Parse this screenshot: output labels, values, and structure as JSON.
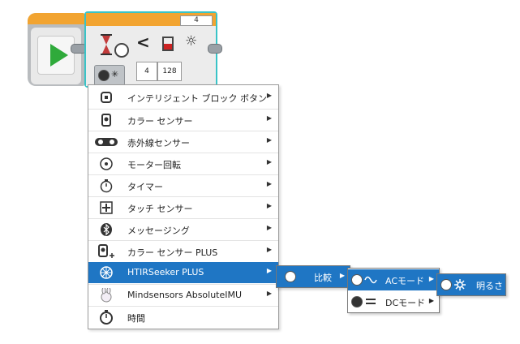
{
  "block": {
    "port": "4",
    "inputs": [
      "4",
      "128"
    ],
    "compare_symbol": "<",
    "sun_symbol": "☼",
    "mode_symbol": "✳"
  },
  "menu": {
    "items": [
      {
        "label": "インテリジェント ブロック ボタン",
        "icon": "brick-buttons-icon",
        "arrow": "▶"
      },
      {
        "label": "カラー センサー",
        "icon": "color-sensor-icon",
        "arrow": "▶"
      },
      {
        "label": "赤外線センサー",
        "icon": "infrared-sensor-icon",
        "arrow": "▶"
      },
      {
        "label": "モーター回転",
        "icon": "motor-rotation-icon",
        "arrow": "▶"
      },
      {
        "label": "タイマー",
        "icon": "timer-icon",
        "arrow": "▶"
      },
      {
        "label": "タッチ センサー",
        "icon": "touch-sensor-icon",
        "arrow": "▶"
      },
      {
        "label": "メッセージング",
        "icon": "bluetooth-icon",
        "arrow": "▶"
      },
      {
        "label": "カラー センサー PLUS",
        "icon": "color-sensor-plus-icon",
        "arrow": "▶"
      },
      {
        "label": "HTIRSeeker PLUS",
        "icon": "ir-seeker-icon",
        "arrow": "▶"
      },
      {
        "label": "Mindsensors AbsoluteIMU",
        "icon": "imu-icon",
        "arrow": "▶"
      },
      {
        "label": "時間",
        "icon": "time-icon",
        "arrow": ""
      }
    ],
    "selected_index": 8
  },
  "submenu1": {
    "label": "比較",
    "arrow": "▶"
  },
  "submenu2": {
    "items": [
      {
        "label": "ACモード",
        "arrow": "▶"
      },
      {
        "label": "DCモード",
        "arrow": "▶"
      }
    ]
  },
  "submenu3": {
    "label": "明るさ"
  },
  "colors": {
    "accent": "#1f76c4",
    "block_orange": "#f2a431",
    "selection_border": "#39c3c7",
    "play_green": "#2faa3b"
  }
}
